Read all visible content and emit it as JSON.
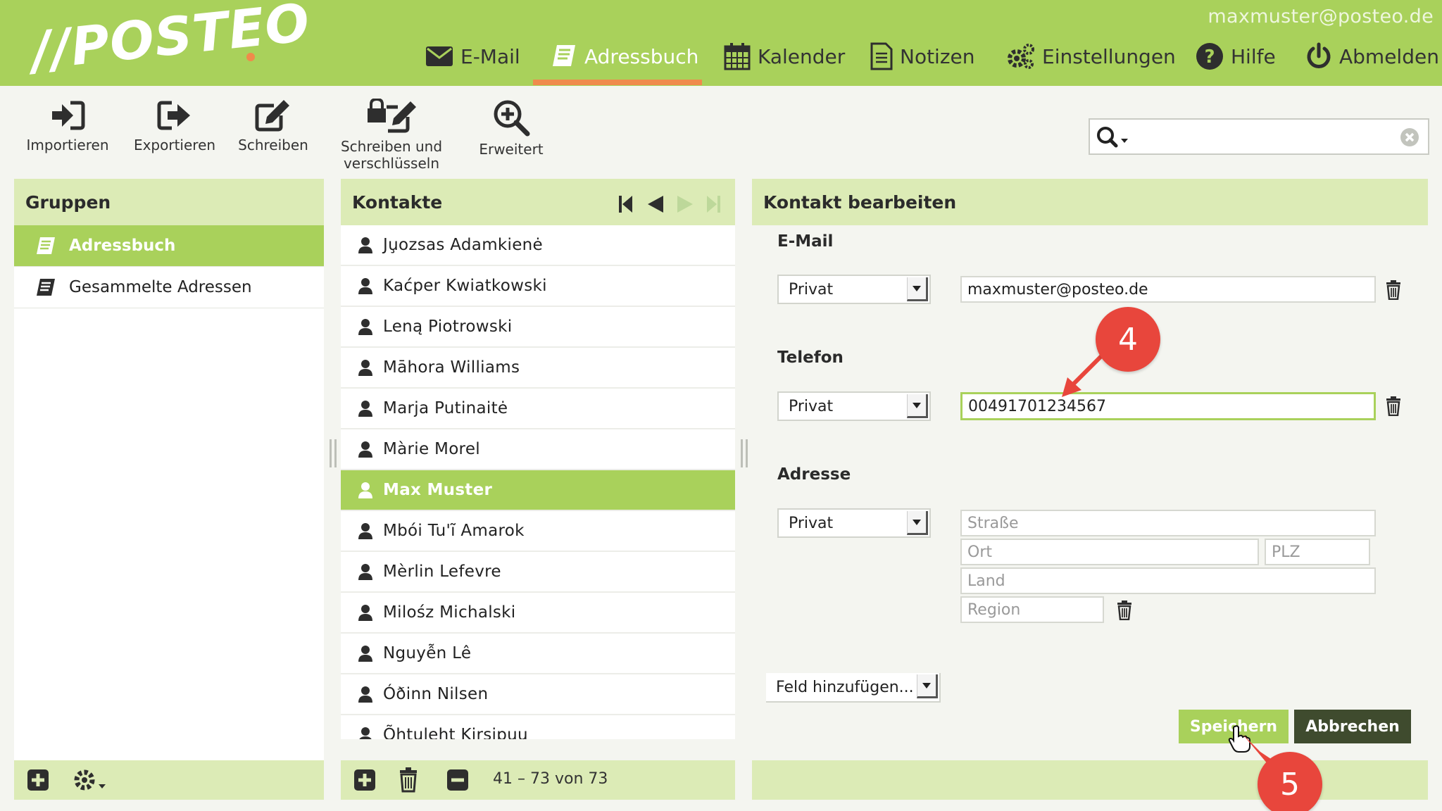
{
  "header": {
    "user_email": "maxmuster@posteo.de",
    "logo": "//POSTEO",
    "nav": [
      {
        "label": "E-Mail",
        "icon": "envelope-icon"
      },
      {
        "label": "Adressbuch",
        "icon": "address-book-icon",
        "active": true
      },
      {
        "label": "Kalender",
        "icon": "calendar-icon"
      },
      {
        "label": "Notizen",
        "icon": "notes-icon"
      },
      {
        "label": "Einstellungen",
        "icon": "gears-icon"
      },
      {
        "label": "Hilfe",
        "icon": "help-icon"
      },
      {
        "label": "Abmelden",
        "icon": "power-icon"
      }
    ]
  },
  "toolbar": {
    "import": "Importieren",
    "export": "Exportieren",
    "write": "Schreiben",
    "write_encrypt_1": "Schreiben und",
    "write_encrypt_2": "verschlüsseln",
    "advanced": "Erweitert"
  },
  "search": {
    "value": "",
    "placeholder": ""
  },
  "groups": {
    "title": "Gruppen",
    "items": [
      {
        "label": "Adressbuch",
        "selected": true
      },
      {
        "label": "Gesammelte Adressen",
        "selected": false
      }
    ]
  },
  "contacts": {
    "title": "Kontakte",
    "items": [
      "Ju̧ozsas Adamkienė",
      "Kaćper Kwiatkowski",
      "Leną Piotrowski",
      "Māhora Williams",
      "Marja Putinaitė",
      "Màrie Morel",
      "Max Muster",
      "Mbói Tu'ĩ Amarok",
      "Mèrlin Lefevre",
      "Milośz Michalski",
      "Nguyễn Lê",
      "Óðinn Nilsen",
      "Õhtuleht Kirsipuu"
    ],
    "selected": "Max Muster",
    "count": "41 – 73 von 73"
  },
  "edit": {
    "title": "Kontakt bearbeiten",
    "email_label": "E-Mail",
    "email_type": "Privat",
    "email_value": "maxmuster@posteo.de",
    "phone_label": "Telefon",
    "phone_type": "Privat",
    "phone_value": "00491701234567",
    "address_label": "Adresse",
    "address_type": "Privat",
    "street_placeholder": "Straße",
    "city_placeholder": "Ort",
    "zip_placeholder": "PLZ",
    "country_placeholder": "Land",
    "region_placeholder": "Region",
    "add_field": "Feld hinzufügen...",
    "save": "Speichern",
    "cancel": "Abbrechen"
  },
  "annotations": {
    "step4": "4",
    "step5": "5"
  },
  "colors": {
    "brand": "#a9d15b",
    "accent": "#ef8b4d",
    "badge": "#e8463c",
    "dark_button": "#3f4b2e"
  }
}
